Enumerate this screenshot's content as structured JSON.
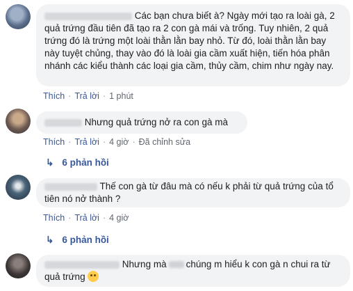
{
  "comments": [
    {
      "text": "Các bạn chưa biết à? Ngày mới tạo ra loài gà, 2 quả trứng đầu tiên đã tạo ra 2 con gà mái và trống. Tuy nhiên, 2 quả trứng đó là trứng một loài thằn lằn bay nhỏ. Từ đó, loài thằn lằn bay này tuyệt chủng, thay vào đó là loài gia cầm xuất hiện, tiến hóa phân nhánh các kiểu thành các loại gia cầm, thủy cầm, chim như ngày nay.",
      "like": "Thích",
      "reply": "Trả lời",
      "time": "1 phút"
    },
    {
      "text": "Nhưng quả trứng nở ra con gà mà",
      "like": "Thích",
      "reply": "Trả lời",
      "time": "4 giờ",
      "edited": "Đã chỉnh sửa",
      "replies": "6 phản hồi"
    },
    {
      "text": "Thế con gà từ đâu mà có nếu k phải từ quả trứng của tổ tiên nó nở thành ?",
      "like": "Thích",
      "reply": "Trả lời",
      "time": "4 giờ",
      "replies": "6 phản hồi"
    },
    {
      "text_before": "Nhưng mà",
      "text_after": "chúng m hiểu k con gà n chui ra từ quả trứng"
    }
  ],
  "colors": {
    "link": "#385898",
    "bubble": "#f2f3f5",
    "meta": "#606770"
  },
  "icons": {
    "reply_arrow": "reply-arrow-icon",
    "emoji": "grinning-emoji-icon"
  }
}
